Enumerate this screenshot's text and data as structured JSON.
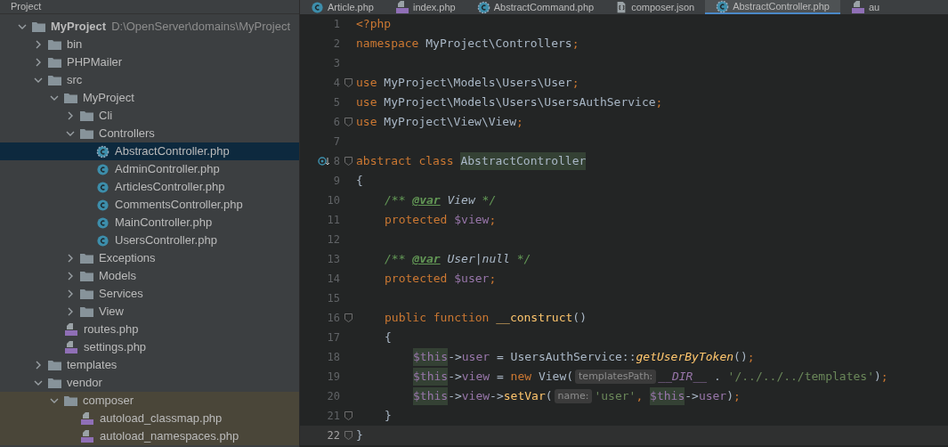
{
  "sidebar": {
    "title": "Project",
    "tree": [
      {
        "name": "MyProject",
        "path": "D:\\OpenServer\\domains\\MyProject",
        "kind": "folder",
        "expanded": true,
        "selected": false,
        "library": false,
        "children": [
          {
            "name": "bin",
            "kind": "folder",
            "expanded": false,
            "selected": false,
            "library": false
          },
          {
            "name": "PHPMailer",
            "kind": "folder",
            "expanded": false,
            "selected": false,
            "library": false
          },
          {
            "name": "src",
            "kind": "folder",
            "expanded": true,
            "selected": false,
            "library": false,
            "children": [
              {
                "name": "MyProject",
                "kind": "folder",
                "expanded": true,
                "selected": false,
                "library": false,
                "children": [
                  {
                    "name": "Cli",
                    "kind": "folder",
                    "expanded": false,
                    "selected": false,
                    "library": false
                  },
                  {
                    "name": "Controllers",
                    "kind": "folder",
                    "expanded": true,
                    "selected": false,
                    "library": false,
                    "children": [
                      {
                        "name": "AbstractController.php",
                        "kind": "abstract",
                        "selected": true,
                        "library": false
                      },
                      {
                        "name": "AdminController.php",
                        "kind": "class",
                        "selected": false,
                        "library": false
                      },
                      {
                        "name": "ArticlesController.php",
                        "kind": "class",
                        "selected": false,
                        "library": false
                      },
                      {
                        "name": "CommentsController.php",
                        "kind": "class",
                        "selected": false,
                        "library": false
                      },
                      {
                        "name": "MainController.php",
                        "kind": "class",
                        "selected": false,
                        "library": false
                      },
                      {
                        "name": "UsersController.php",
                        "kind": "class",
                        "selected": false,
                        "library": false
                      }
                    ]
                  },
                  {
                    "name": "Exceptions",
                    "kind": "folder",
                    "expanded": false,
                    "selected": false,
                    "library": false
                  },
                  {
                    "name": "Models",
                    "kind": "folder",
                    "expanded": false,
                    "selected": false,
                    "library": false
                  },
                  {
                    "name": "Services",
                    "kind": "folder",
                    "expanded": false,
                    "selected": false,
                    "library": false
                  },
                  {
                    "name": "View",
                    "kind": "folder",
                    "expanded": false,
                    "selected": false,
                    "library": false
                  }
                ]
              },
              {
                "name": "routes.php",
                "kind": "php",
                "selected": false,
                "library": false
              },
              {
                "name": "settings.php",
                "kind": "php",
                "selected": false,
                "library": false
              }
            ]
          },
          {
            "name": "templates",
            "kind": "folder",
            "expanded": false,
            "selected": false,
            "library": false
          },
          {
            "name": "vendor",
            "kind": "folder",
            "expanded": true,
            "selected": false,
            "library": false,
            "children": [
              {
                "name": "composer",
                "kind": "folder",
                "expanded": true,
                "selected": false,
                "library": true,
                "children": [
                  {
                    "name": "autoload_classmap.php",
                    "kind": "php",
                    "selected": false,
                    "library": true
                  },
                  {
                    "name": "autoload_namespaces.php",
                    "kind": "php",
                    "selected": false,
                    "library": true
                  }
                ]
              }
            ]
          }
        ]
      }
    ]
  },
  "tabs": [
    {
      "label": "Article.php",
      "kind": "class",
      "selected": false
    },
    {
      "label": "index.php",
      "kind": "php",
      "selected": false
    },
    {
      "label": "AbstractCommand.php",
      "kind": "abstract",
      "selected": false
    },
    {
      "label": "composer.json",
      "kind": "json",
      "selected": false
    },
    {
      "label": "AbstractController.php",
      "kind": "abstract",
      "selected": true
    },
    {
      "label": "au",
      "kind": "php",
      "selected": false
    }
  ],
  "editor": {
    "lines": [
      {
        "n": "1",
        "kind": "top",
        "current": false,
        "tokens": [
          {
            "t": "<?php",
            "kind": "kw"
          }
        ]
      },
      {
        "n": "2",
        "kind": "top",
        "current": false,
        "tokens": [
          {
            "t": "namespace ",
            "kind": "kw"
          },
          {
            "t": "MyProject\\Controllers",
            "kind": "plain"
          },
          {
            "t": ";",
            "kind": "kw"
          }
        ]
      },
      {
        "n": "3",
        "kind": "top",
        "current": false
      },
      {
        "n": "4",
        "kind": "top",
        "current": false,
        "fold": true,
        "tokens": [
          {
            "t": "use ",
            "kind": "kw"
          },
          {
            "t": "MyProject\\Models\\Users\\User",
            "kind": "plain"
          },
          {
            "t": ";",
            "kind": "kw"
          }
        ]
      },
      {
        "n": "5",
        "kind": "top",
        "current": false,
        "tokens": [
          {
            "t": "use ",
            "kind": "kw"
          },
          {
            "t": "MyProject\\Models\\Users\\UsersAuthService",
            "kind": "plain"
          },
          {
            "t": ";",
            "kind": "kw"
          }
        ]
      },
      {
        "n": "6",
        "kind": "top",
        "current": false,
        "fold": true,
        "tokens": [
          {
            "t": "use ",
            "kind": "kw"
          },
          {
            "t": "MyProject\\View\\View",
            "kind": "plain"
          },
          {
            "t": ";",
            "kind": "kw"
          }
        ]
      },
      {
        "n": "7",
        "kind": "top",
        "current": false
      },
      {
        "n": "8",
        "kind": "top",
        "current": false,
        "fold": true,
        "marker": true,
        "tokens": [
          {
            "t": "abstract class ",
            "kind": "kw"
          },
          {
            "t": "AbstractController",
            "kind": "decl"
          }
        ]
      },
      {
        "n": "9",
        "kind": "top",
        "current": false,
        "tokens": [
          {
            "t": "{",
            "kind": "plain"
          }
        ]
      },
      {
        "n": "10",
        "kind": "member",
        "current": false,
        "tokens": [
          {
            "t": "/** ",
            "kind": "cm"
          },
          {
            "t": "@var",
            "kind": "tag"
          },
          {
            "t": " View",
            "kind": "type"
          },
          {
            "t": " */",
            "kind": "cm"
          }
        ]
      },
      {
        "n": "11",
        "kind": "member",
        "current": false,
        "tokens": [
          {
            "t": "protected ",
            "kind": "kw"
          },
          {
            "t": "$view",
            "kind": "var"
          },
          {
            "t": ";",
            "kind": "kw"
          }
        ]
      },
      {
        "n": "12",
        "kind": "top",
        "current": false
      },
      {
        "n": "13",
        "kind": "member",
        "current": false,
        "tokens": [
          {
            "t": "/** ",
            "kind": "cm"
          },
          {
            "t": "@var",
            "kind": "tag"
          },
          {
            "t": " User|null",
            "kind": "type"
          },
          {
            "t": " */",
            "kind": "cm"
          }
        ]
      },
      {
        "n": "14",
        "kind": "member",
        "current": false,
        "tokens": [
          {
            "t": "protected ",
            "kind": "kw"
          },
          {
            "t": "$user",
            "kind": "var"
          },
          {
            "t": ";",
            "kind": "kw"
          }
        ]
      },
      {
        "n": "15",
        "kind": "top",
        "current": false
      },
      {
        "n": "16",
        "kind": "member",
        "current": false,
        "fold": true,
        "tokens": [
          {
            "t": "public function ",
            "kind": "kw"
          },
          {
            "t": "__construct",
            "kind": "call"
          },
          {
            "t": "()",
            "kind": "plain"
          }
        ]
      },
      {
        "n": "17",
        "kind": "member",
        "current": false,
        "tokens": [
          {
            "t": "{",
            "kind": "plain"
          }
        ]
      },
      {
        "n": "18",
        "kind": "statement",
        "current": false,
        "tokens": [
          {
            "t": "$this",
            "kind": "this"
          },
          {
            "t": "->",
            "kind": "plain"
          },
          {
            "t": "user",
            "kind": "var"
          },
          {
            "t": " = UsersAuthService::",
            "kind": "plain"
          },
          {
            "t": "getUserByToken",
            "kind": "fn"
          },
          {
            "t": "()",
            "kind": "plain"
          },
          {
            "t": ";",
            "kind": "kw"
          }
        ]
      },
      {
        "n": "19",
        "kind": "statement",
        "current": false,
        "tokens": [
          {
            "t": "$this",
            "kind": "this"
          },
          {
            "t": "->",
            "kind": "plain"
          },
          {
            "t": "view",
            "kind": "var"
          },
          {
            "t": " = ",
            "kind": "plain"
          },
          {
            "t": "new ",
            "kind": "kw"
          },
          {
            "t": "View(",
            "kind": "plain"
          },
          {
            "t": "templatesPath:",
            "kind": "hint"
          },
          {
            "t": "__DIR__",
            "kind": "const"
          },
          {
            "t": " . ",
            "kind": "plain"
          },
          {
            "t": "'/../../../templates'",
            "kind": "str"
          },
          {
            "t": ")",
            "kind": "plain"
          },
          {
            "t": ";",
            "kind": "kw"
          }
        ]
      },
      {
        "n": "20",
        "kind": "statement",
        "current": false,
        "tokens": [
          {
            "t": "$this",
            "kind": "this"
          },
          {
            "t": "->",
            "kind": "plain"
          },
          {
            "t": "view",
            "kind": "var"
          },
          {
            "t": "->",
            "kind": "plain"
          },
          {
            "t": "setVar",
            "kind": "call"
          },
          {
            "t": "(",
            "kind": "plain"
          },
          {
            "t": "name:",
            "kind": "hint"
          },
          {
            "t": "'user'",
            "kind": "str"
          },
          {
            "t": ", ",
            "kind": "kw"
          },
          {
            "t": "$this",
            "kind": "this"
          },
          {
            "t": "->",
            "kind": "plain"
          },
          {
            "t": "user",
            "kind": "var"
          },
          {
            "t": ")",
            "kind": "plain"
          },
          {
            "t": ";",
            "kind": "kw"
          }
        ]
      },
      {
        "n": "21",
        "kind": "member",
        "current": false,
        "fold": true,
        "tokens": [
          {
            "t": "}",
            "kind": "plain"
          }
        ]
      },
      {
        "n": "22",
        "kind": "top",
        "current": true,
        "fold": true,
        "tokens": [
          {
            "t": "}",
            "kind": "plain"
          }
        ]
      }
    ]
  }
}
